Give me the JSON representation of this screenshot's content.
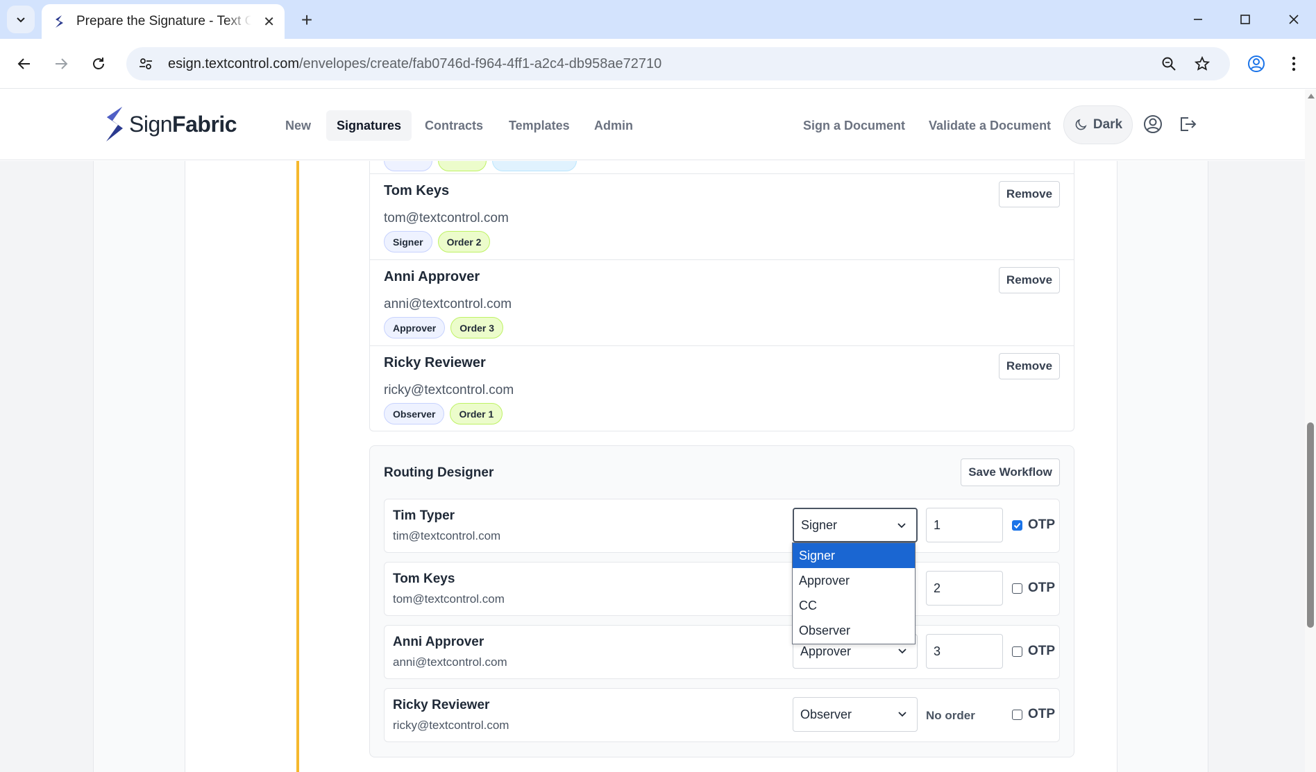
{
  "browser": {
    "tab_title": "Prepare the Signature - Text Control",
    "url_domain": "esign.textcontrol.com",
    "url_path": "/envelopes/create/fab0746d-f964-4ff1-a2c4-db958ae72710"
  },
  "header": {
    "logo_light": "Sign",
    "logo_bold": "Fabric",
    "nav": [
      "New",
      "Signatures",
      "Contracts",
      "Templates",
      "Admin"
    ],
    "active_nav": "Signatures",
    "sign_document": "Sign a Document",
    "validate_document": "Validate a Document",
    "dark_label": "Dark"
  },
  "recipients": [
    {
      "name": "Tom Keys",
      "email": "tom@textcontrol.com",
      "role": "Signer",
      "order": "Order 2"
    },
    {
      "name": "Anni Approver",
      "email": "anni@textcontrol.com",
      "role": "Approver",
      "order": "Order 3"
    },
    {
      "name": "Ricky Reviewer",
      "email": "ricky@textcontrol.com",
      "role": "Observer",
      "order": "Order 1"
    }
  ],
  "remove_label": "Remove",
  "routing": {
    "title": "Routing Designer",
    "save_label": "Save Workflow",
    "otp_label": "OTP",
    "no_order_label": "No order",
    "rows": [
      {
        "name": "Tim Typer",
        "email": "tim@textcontrol.com",
        "role": "Signer",
        "order": "1",
        "otp": true
      },
      {
        "name": "Tom Keys",
        "email": "tom@textcontrol.com",
        "role": "Signer",
        "order": "2",
        "otp": false
      },
      {
        "name": "Anni Approver",
        "email": "anni@textcontrol.com",
        "role": "Approver",
        "order": "3",
        "otp": false
      },
      {
        "name": "Ricky Reviewer",
        "email": "ricky@textcontrol.com",
        "role": "Observer",
        "order": "",
        "otp": false
      }
    ]
  },
  "dropdown": {
    "options": [
      "Signer",
      "Approver",
      "CC",
      "Observer"
    ],
    "selected": "Signer"
  },
  "colors": {
    "accent_timeline": "#f5b82e",
    "dropdown_highlight": "#1a66d2",
    "logo_blue": "#2b3a8f"
  }
}
